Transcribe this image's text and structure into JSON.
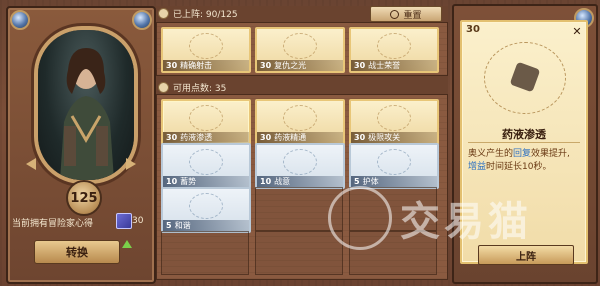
{
  "hero": {
    "level": "125",
    "owned_label": "当前拥有冒险家心得",
    "owned_count": "30",
    "convert_label": "转换"
  },
  "equipped": {
    "header": "已上阵: 90/125",
    "reset_label": "重置",
    "cards": [
      {
        "num": "30",
        "name": "精确射击",
        "style": "gold"
      },
      {
        "num": "30",
        "name": "复仇之光",
        "style": "gold"
      },
      {
        "num": "30",
        "name": "战士荣誉",
        "style": "gold"
      }
    ]
  },
  "available": {
    "header": "可用点数: 35",
    "cards": [
      {
        "num": "30",
        "name": "药液渗透",
        "style": "gold"
      },
      {
        "num": "30",
        "name": "药液精通",
        "style": "gold"
      },
      {
        "num": "30",
        "name": "极限攻关",
        "style": "gold"
      },
      {
        "num": "10",
        "name": "蓄势",
        "style": "blue"
      },
      {
        "num": "10",
        "name": "战意",
        "style": "blue"
      },
      {
        "num": "5",
        "name": "护体",
        "style": "blue"
      },
      {
        "num": "5",
        "name": "和谐",
        "style": "blue"
      }
    ]
  },
  "detail": {
    "num": "30",
    "name": "药液渗透",
    "desc_1": "奥义产生的",
    "desc_hl1": "回复",
    "desc_2": "效果提升, ",
    "desc_hl2": "增益",
    "desc_3": "时间延长10秒。",
    "equip_label": "上阵"
  },
  "watermark": {
    "text": "交易猫"
  },
  "colors": {
    "gold_card": "#eed7a0",
    "blue_card": "#d5e0ea",
    "frame": "#6a4432",
    "highlight": "#2b6fc2"
  }
}
